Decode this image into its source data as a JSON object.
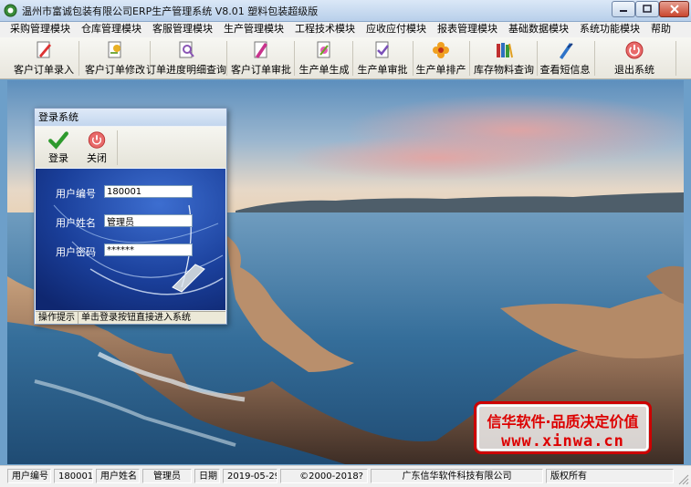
{
  "window": {
    "title": "温州市富诚包装有限公司ERP生产管理系统  V8.01  塑料包装超级版"
  },
  "menu": {
    "items": [
      "采购管理模块",
      "仓库管理模块",
      "客服管理模块",
      "生产管理模块",
      "工程技术模块",
      "应收应付模块",
      "报表管理模块",
      "基础数据模块",
      "系统功能模块",
      "帮助"
    ]
  },
  "toolbar": {
    "buttons": [
      {
        "label": "客户订单录入",
        "icon": "doc-pen-icon"
      },
      {
        "label": "客户订单修改",
        "icon": "doc-edit-icon"
      },
      {
        "label": "订单进度明细查询",
        "icon": "doc-search-icon"
      },
      {
        "label": "客户订单审批",
        "icon": "doc-approve-icon"
      },
      {
        "label": "生产单生成",
        "icon": "doc-create-icon"
      },
      {
        "label": "生产单审批",
        "icon": "doc-check-icon"
      },
      {
        "label": "生产单排产",
        "icon": "flower-icon"
      },
      {
        "label": "库存物料查询",
        "icon": "books-icon"
      },
      {
        "label": "查看短信息",
        "icon": "message-icon"
      },
      {
        "label": "退出系统",
        "icon": "power-icon"
      }
    ]
  },
  "login": {
    "title": "登录系统",
    "login_label": "登录",
    "close_label": "关闭",
    "user_code_label": "用户编号",
    "user_code_value": "180001",
    "user_name_label": "用户姓名",
    "user_name_value": "管理员",
    "password_label": "用户密码",
    "password_value": "******",
    "hint_label": "操作提示",
    "hint_text": "单击登录按钮直接进入系统"
  },
  "watermark": {
    "line1": "信华软件·品质决定价值",
    "line2": "www.xinwa.cn"
  },
  "statusbar": {
    "user_code_label": "用户编号",
    "user_code_value": "180001",
    "user_name_label": "用户姓名",
    "user_name_value": "管理员",
    "date_label": "日期",
    "date_value": "2019-05-29",
    "copyright_year": "©2000-2018?",
    "company": "广东信华软件科技有限公司",
    "rights": "版权所有"
  },
  "colors": {
    "title_bar": "#c7d9ef",
    "dialog_panel": "#1d3f9a",
    "watermark_red": "#dd0000"
  }
}
